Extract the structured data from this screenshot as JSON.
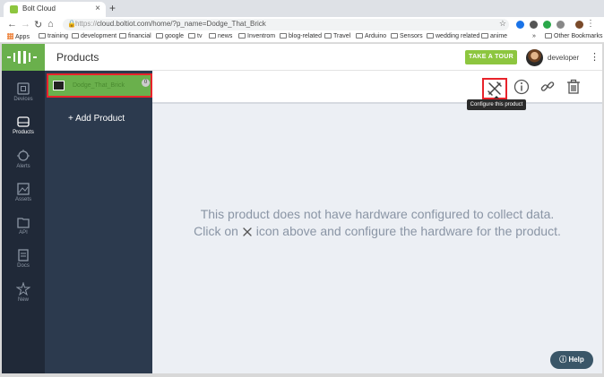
{
  "browser": {
    "tab_title": "Bolt Cloud",
    "tab_close": "×",
    "new_tab": "+",
    "url_prefix": "https://",
    "url": "cloud.boltiot.com/home/?p_name=Dodge_That_Brick",
    "bookmarks": [
      "Apps",
      "training",
      "development",
      "financial",
      "google",
      "tv",
      "news",
      "Inventrom",
      "blog-related",
      "Travel",
      "Arduino",
      "Sensors",
      "wedding related",
      "anime"
    ],
    "overflow": "»",
    "other_bookmarks": "Other Bookmarks"
  },
  "header": {
    "page_title": "Products",
    "tour_button": "TAKE A TOUR",
    "user_name": "developer"
  },
  "sidebar": {
    "items": [
      {
        "label": "Devices",
        "icon": "devices-icon",
        "active": false
      },
      {
        "label": "Products",
        "icon": "products-icon",
        "active": true
      },
      {
        "label": "Alerts",
        "icon": "alerts-icon",
        "active": false
      },
      {
        "label": "Assets",
        "icon": "assets-icon",
        "active": false
      },
      {
        "label": "API",
        "icon": "api-icon",
        "active": false
      },
      {
        "label": "Docs",
        "icon": "docs-icon",
        "active": false
      },
      {
        "label": "New",
        "icon": "new-icon",
        "active": false
      }
    ]
  },
  "products_panel": {
    "product_name": "Dodge_That_Brick",
    "device_count": "0",
    "add_label": "+ Add Product"
  },
  "actions": {
    "tooltip": "Configure this product",
    "icons": [
      "configure-icon",
      "info-icon",
      "link-icon",
      "trash-icon"
    ]
  },
  "empty_state": {
    "line1": "This product does not have hardware configured to collect data.",
    "line2_before": "Click on",
    "line2_after": "icon above and configure the hardware for the product."
  },
  "help_button": "Help",
  "colors": {
    "brand_green": "#6ab04c",
    "tour_green": "#8dc63f",
    "sidebar_dark": "#202938",
    "panel_dark": "#2c3a4e",
    "highlight_red": "#e8232b",
    "help_blue": "#3a5668"
  }
}
